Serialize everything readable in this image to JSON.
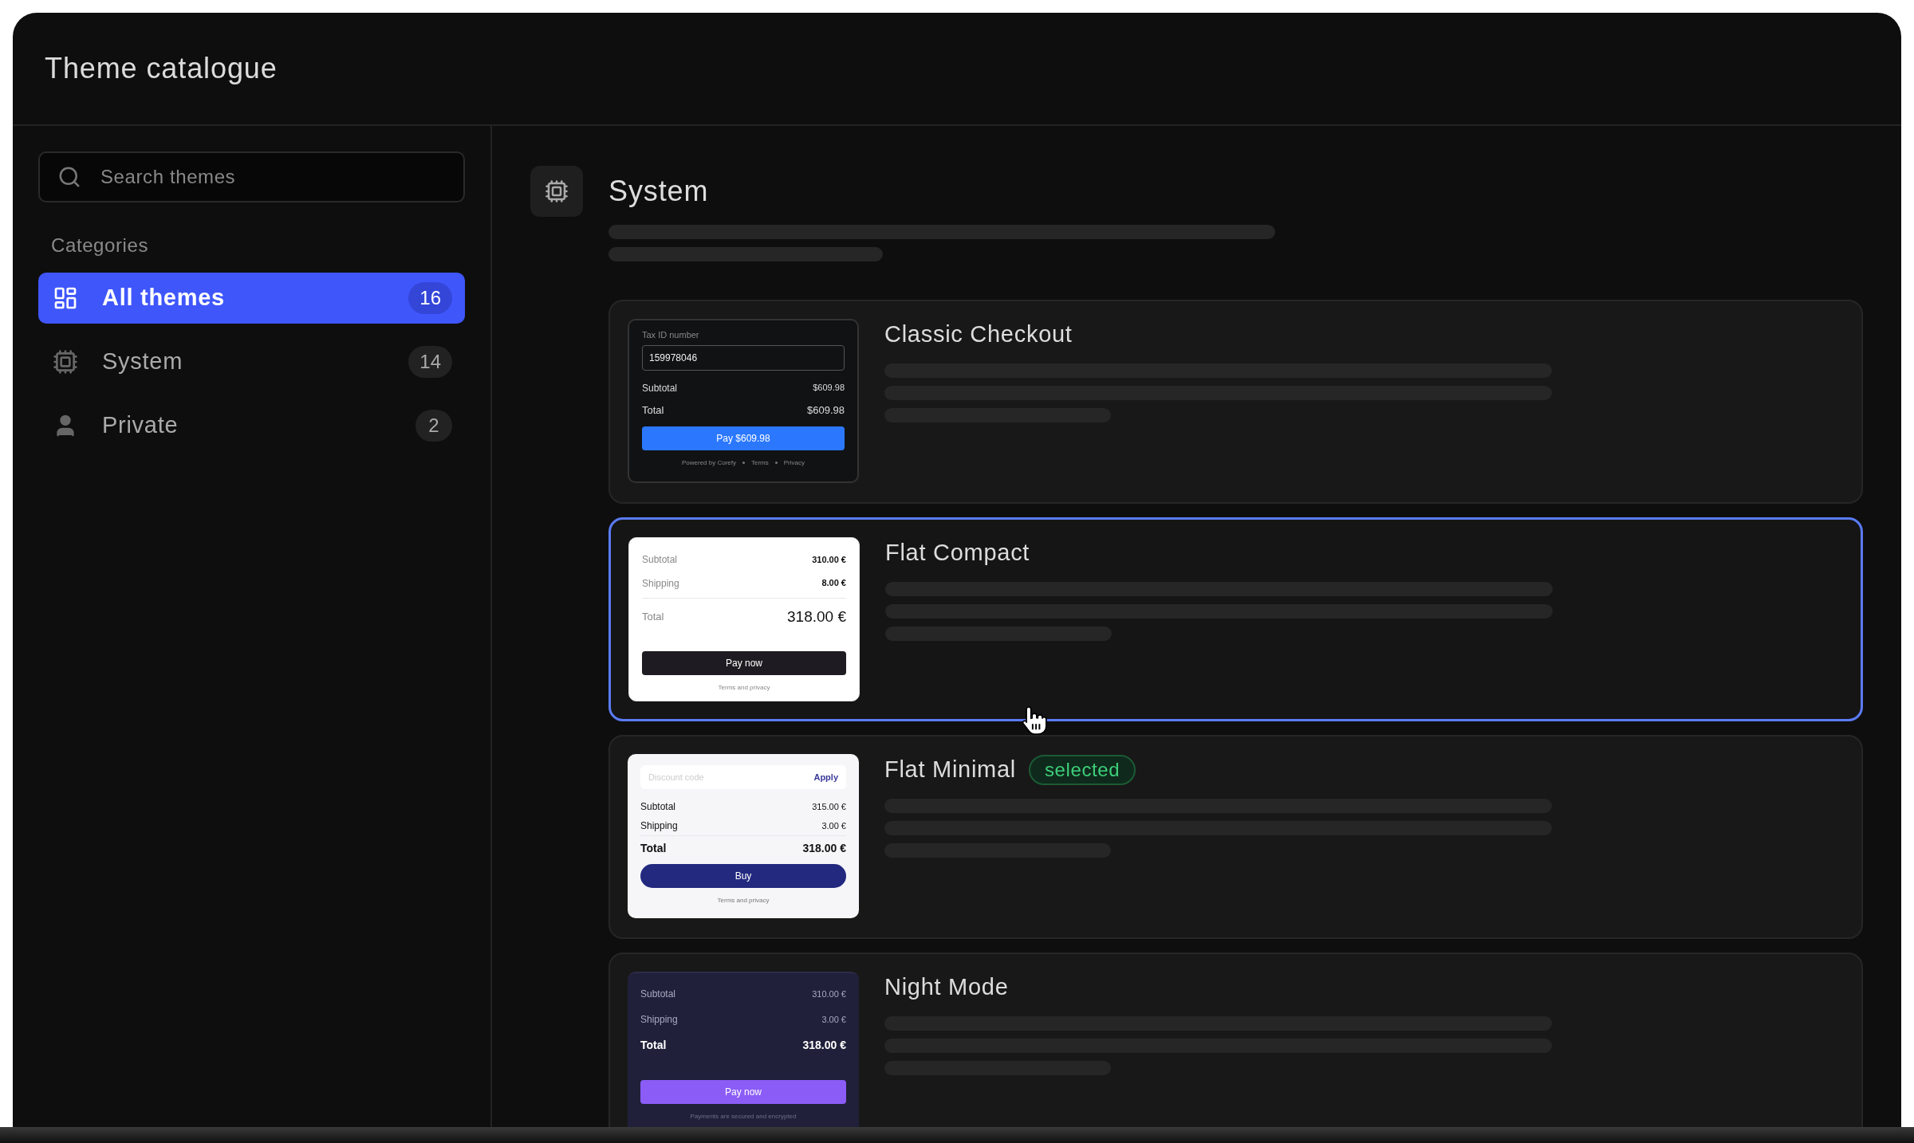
{
  "window": {
    "title": "Theme catalogue"
  },
  "sidebar": {
    "search": {
      "placeholder": "Search themes"
    },
    "section_label": "Categories",
    "categories": [
      {
        "kind": "all",
        "label": "All themes",
        "count": "16",
        "selected": true
      },
      {
        "kind": "system",
        "label": "System",
        "count": "14",
        "selected": false
      },
      {
        "kind": "private",
        "label": "Private",
        "count": "2",
        "selected": false
      }
    ]
  },
  "main": {
    "kind": "system",
    "heading": "System",
    "selected_badge": "selected",
    "themes": [
      {
        "name": "Classic Checkout",
        "selected": false,
        "highlighted": false,
        "preview": {
          "kind": "dark",
          "parts": [
            {
              "kind": "field",
              "label": "Tax ID number",
              "value": "159978046"
            },
            {
              "kind": "row",
              "label": "Subtotal",
              "value": "$609.98"
            },
            {
              "kind": "total",
              "label": "Total",
              "value": "$609.98"
            },
            {
              "kind": "button",
              "label": "Pay $609.98"
            },
            {
              "kind": "footer",
              "links": [
                "Powered by Corefy",
                "Terms",
                "Privacy"
              ]
            }
          ]
        }
      },
      {
        "name": "Flat Compact",
        "selected": false,
        "highlighted": true,
        "preview": {
          "kind": "light",
          "parts": [
            {
              "kind": "row",
              "label": "Subtotal",
              "value": "310.00 €"
            },
            {
              "kind": "row",
              "label": "Shipping",
              "value": "8.00 €"
            },
            {
              "kind": "total",
              "label": "Total",
              "value": "318.00 €"
            },
            {
              "kind": "button",
              "label": "Pay now"
            },
            {
              "kind": "footer",
              "links": [
                "Terms and privacy"
              ]
            }
          ]
        }
      },
      {
        "name": "Flat Minimal",
        "selected": true,
        "highlighted": false,
        "preview": {
          "kind": "soft",
          "parts": [
            {
              "kind": "discount",
              "placeholder": "Discount code",
              "action": "Apply"
            },
            {
              "kind": "row",
              "label": "Subtotal",
              "value": "315.00 €"
            },
            {
              "kind": "row",
              "label": "Shipping",
              "value": "3.00 €"
            },
            {
              "kind": "total",
              "label": "Total",
              "value": "318.00 €"
            },
            {
              "kind": "button",
              "label": "Buy"
            },
            {
              "kind": "footer",
              "links": [
                "Terms and privacy"
              ]
            }
          ]
        }
      },
      {
        "name": "Night Mode",
        "selected": false,
        "highlighted": false,
        "preview": {
          "kind": "night",
          "parts": [
            {
              "kind": "row",
              "label": "Subtotal",
              "value": "310.00 €"
            },
            {
              "kind": "row",
              "label": "Shipping",
              "value": "3.00 €"
            },
            {
              "kind": "total",
              "label": "Total",
              "value": "318.00 €"
            },
            {
              "kind": "button",
              "label": "Pay now"
            },
            {
              "kind": "footer",
              "links": [
                "Payments are secured and encrypted"
              ]
            }
          ]
        }
      }
    ]
  }
}
